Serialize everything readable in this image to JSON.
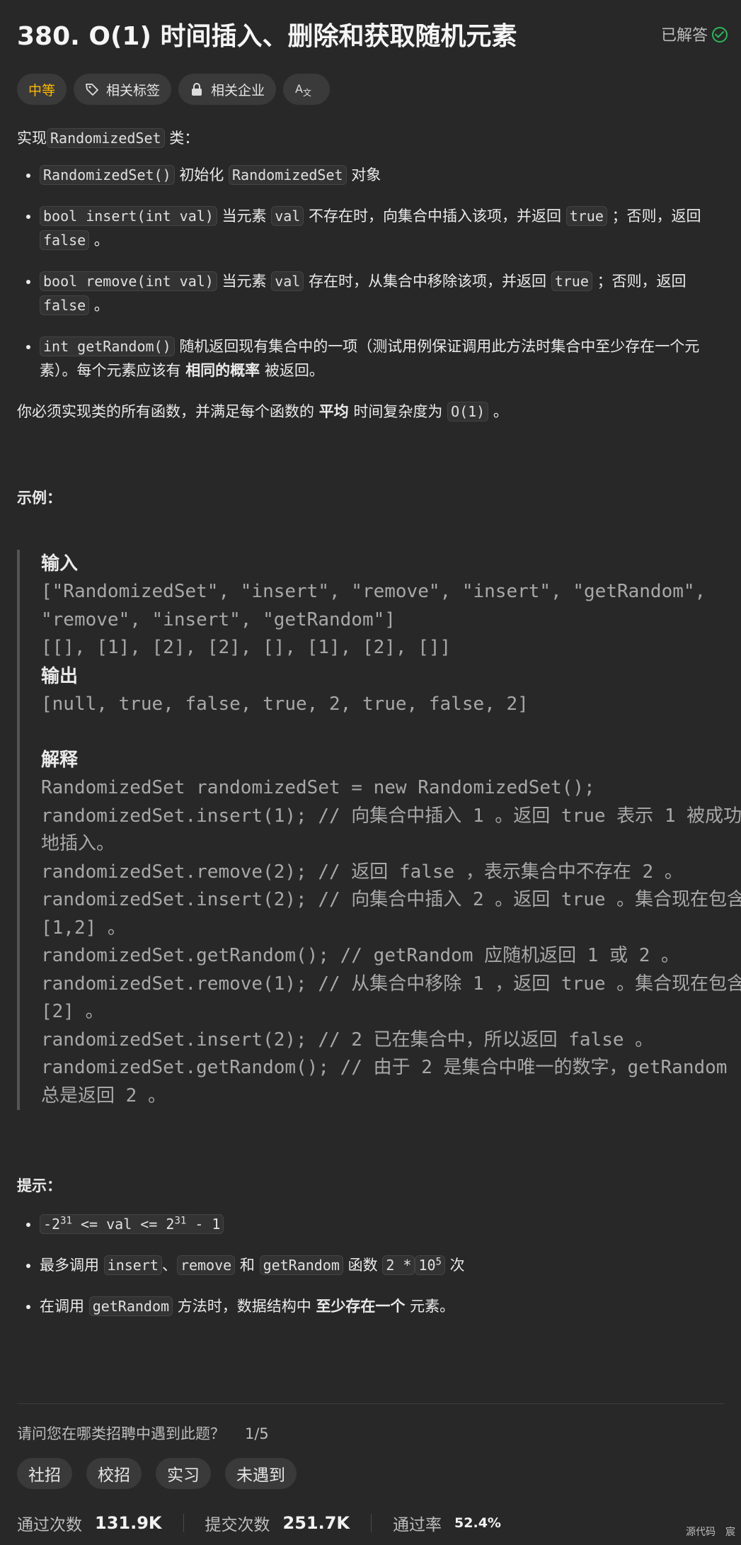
{
  "header": {
    "title": "380. O(1) 时间插入、删除和获取随机元素",
    "status": "已解答"
  },
  "tags": {
    "difficulty": "中等",
    "related_tags": "相关标签",
    "related_companies": "相关企业",
    "translate_icon": "translate-icon"
  },
  "description": {
    "intro_prefix": "实现",
    "intro_code": "RandomizedSet",
    "intro_suffix": "类：",
    "b1_code": "RandomizedSet()",
    "b1_text1": "初始化",
    "b1_code2": "RandomizedSet",
    "b1_text2": "对象",
    "b2_code": "bool insert(int val)",
    "b2_text1": "当元素",
    "b2_code2": "val",
    "b2_text2": "不存在时，向集合中插入该项，并返回",
    "b2_code3": "true",
    "b2_text3": "；否则，返回",
    "b2_code4": "false",
    "b2_text4": "。",
    "b3_code": "bool remove(int val)",
    "b3_text1": "当元素",
    "b3_code2": "val",
    "b3_text2": "存在时，从集合中移除该项，并返回",
    "b3_code3": "true",
    "b3_text3": "；否则，返回",
    "b3_code4": "false",
    "b3_text4": "。",
    "b4_code": "int getRandom()",
    "b4_text1": "随机返回现有集合中的一项（测试用例保证调用此方法时集合中至少存在一个元素）。每个元素应该有",
    "b4_bold": "相同的概率",
    "b4_text2": "被返回。",
    "req_text1": "你必须实现类的所有函数，并满足每个函数的",
    "req_bold": "平均",
    "req_text2": "时间复杂度为",
    "req_code": "O(1)",
    "req_text3": "。"
  },
  "example": {
    "heading": "示例：",
    "input_label": "输入",
    "input_text": "[\"RandomizedSet\", \"insert\", \"remove\", \"insert\", \"getRandom\", \"remove\", \"insert\", \"getRandom\"]\n[[], [1], [2], [2], [], [1], [2], []]",
    "output_label": "输出",
    "output_text": "[null, true, false, true, 2, true, false, 2]",
    "explain_label": "解释",
    "explain_text": "RandomizedSet randomizedSet = new RandomizedSet();\nrandomizedSet.insert(1); // 向集合中插入 1 。返回 true 表示 1 被成功地插入。\nrandomizedSet.remove(2); // 返回 false ，表示集合中不存在 2 。\nrandomizedSet.insert(2); // 向集合中插入 2 。返回 true 。集合现在包含 [1,2] 。\nrandomizedSet.getRandom(); // getRandom 应随机返回 1 或 2 。\nrandomizedSet.remove(1); // 从集合中移除 1 ，返回 true 。集合现在包含 [2] 。\nrandomizedSet.insert(2); // 2 已在集合中，所以返回 false 。\nrandomizedSet.getRandom(); // 由于 2 是集合中唯一的数字，getRandom 总是返回 2 。"
  },
  "hints": {
    "heading": "提示：",
    "c1_base1": "-2",
    "c1_exp1": "31",
    "c1_mid": " <= val <= 2",
    "c1_exp2": "31",
    "c1_tail": " - 1",
    "c2_text1": "最多调用",
    "c2_code1": "insert",
    "c2_sep1": "、",
    "c2_code2": "remove",
    "c2_text2": "和",
    "c2_code3": "getRandom",
    "c2_text3": "函数",
    "c2_code4": "2 *",
    "c2_code5_base": "10",
    "c2_code5_exp": "5",
    "c2_text4": "次",
    "c3_text1": "在调用",
    "c3_code1": "getRandom",
    "c3_text2": "方法时，数据结构中",
    "c3_bold": "至少存在一个",
    "c3_text3": "元素。"
  },
  "survey": {
    "question": "请问您在哪类招聘中遇到此题？",
    "page": "1/5",
    "options": [
      "社招",
      "校招",
      "实习",
      "未遇到"
    ]
  },
  "stats": {
    "accepted_label": "通过次数",
    "accepted_value": "131.9K",
    "submitted_label": "提交次数",
    "submitted_value": "251.7K",
    "rate_label": "通过率",
    "rate_value": "52.4%"
  },
  "footer": {
    "corner_text": "源代码　宸"
  }
}
